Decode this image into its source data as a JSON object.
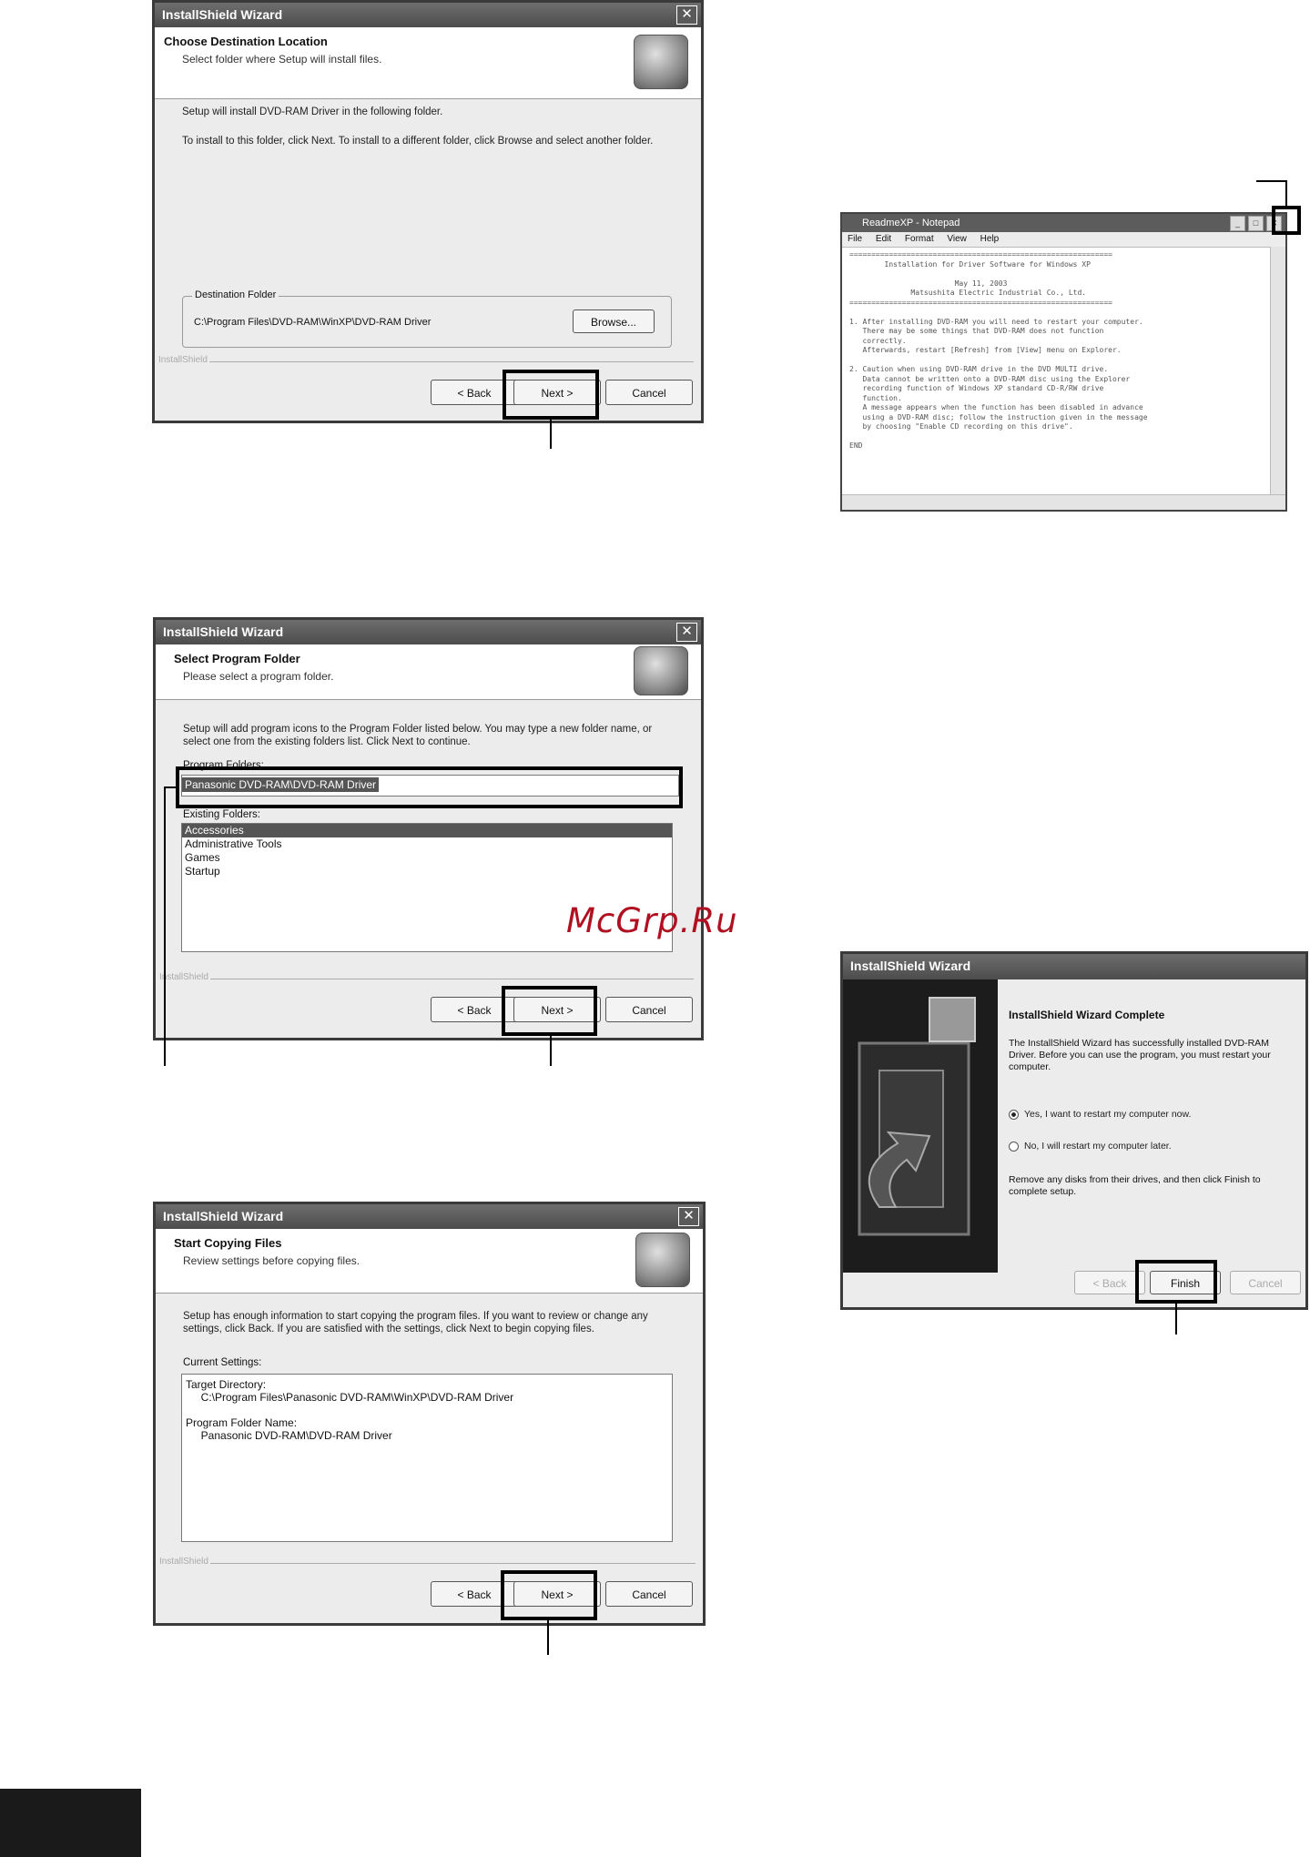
{
  "dialog1": {
    "title": "InstallShield Wizard",
    "header_title": "Choose Destination Location",
    "header_subtitle": "Select folder where Setup will install files.",
    "line1": "Setup will install DVD-RAM Driver in the following folder.",
    "line2": "To install to this folder, click Next. To install to a different folder, click Browse and select another folder.",
    "group_label": "Destination Folder",
    "folder_path": "C:\\Program Files\\DVD-RAM\\WinXP\\DVD-RAM Driver",
    "browse_label": "Browse...",
    "installshield": "InstallShield",
    "back_label": "< Back",
    "next_label": "Next >",
    "cancel_label": "Cancel"
  },
  "dialog2": {
    "title": "InstallShield Wizard",
    "header_title": "Select Program Folder",
    "header_subtitle": "Please select a program folder.",
    "body": "Setup will add program icons to the Program Folder listed below. You may type a new folder name, or select one from the existing folders list. Click Next to continue.",
    "program_folder_label": "Program Folders:",
    "program_folder_value": "Panasonic DVD-RAM\\DVD-RAM Driver",
    "existing_label": "Existing Folders:",
    "existing_folders": [
      "Accessories",
      "Administrative Tools",
      "Games",
      "Startup"
    ],
    "installshield": "InstallShield",
    "back_label": "< Back",
    "next_label": "Next >",
    "cancel_label": "Cancel"
  },
  "dialog3": {
    "title": "InstallShield Wizard",
    "header_title": "Start Copying Files",
    "header_subtitle": "Review settings before copying files.",
    "body": "Setup has enough information to start copying the program files. If you want to review or change any settings, click Back. If you are satisfied with the settings, click Next to begin copying files.",
    "current_label": "Current Settings:",
    "settings_text": "Target Directory:\n     C:\\Program Files\\Panasonic DVD-RAM\\WinXP\\DVD-RAM Driver\n\nProgram Folder Name:\n     Panasonic DVD-RAM\\DVD-RAM Driver",
    "installshield": "InstallShield",
    "back_label": "< Back",
    "next_label": "Next >",
    "cancel_label": "Cancel"
  },
  "notepad": {
    "title": "ReadmeXP - Notepad",
    "menu": [
      "File",
      "Edit",
      "Format",
      "View",
      "Help"
    ],
    "text": "============================================================\n        Installation for Driver Software for Windows XP\n\n                        May 11, 2003\n              Matsushita Electric Industrial Co., Ltd.\n============================================================\n\n1. After installing DVD-RAM you will need to restart your computer.\n   There may be some things that DVD-RAM does not function\n   correctly.\n   Afterwards, restart [Refresh] from [View] menu on Explorer.\n\n2. Caution when using DVD-RAM drive in the DVD MULTI drive.\n   Data cannot be written onto a DVD-RAM disc using the Explorer\n   recording function of Windows XP standard CD-R/RW drive\n   function.\n   A message appears when the function has been disabled in advance\n   using a DVD-RAM disc; follow the instruction given in the message\n   by choosing \"Enable CD recording on this drive\".\n\nEND"
  },
  "dialog4": {
    "title": "InstallShield Wizard",
    "heading": "InstallShield Wizard Complete",
    "body1": "The InstallShield Wizard has successfully installed DVD-RAM Driver. Before you can use the program, you must restart your computer.",
    "radio1": "Yes, I want to restart my computer now.",
    "radio2": "No, I will restart my computer later.",
    "body2": "Remove any disks from their drives, and then click Finish to complete setup.",
    "back_label": "< Back",
    "finish_label": "Finish",
    "cancel_label": "Cancel"
  },
  "watermark": "McGrp.Ru"
}
